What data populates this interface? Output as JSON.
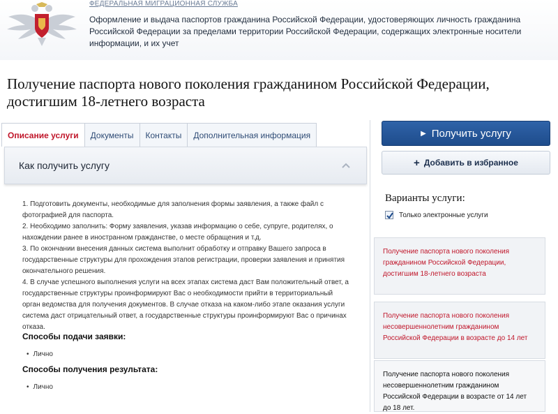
{
  "header": {
    "agency": "ФЕДЕРАЛЬНАЯ МИГРАЦИОННАЯ СЛУЖБА",
    "subtitle": "Оформление и выдача паспортов гражданина Российской Федерации, удостоверяющих личность гражданина Российской Федерации за пределами территории Российской Федерации, содержащих электронные носители информации, и их учет"
  },
  "page": {
    "title": "Получение паспорта нового поколения гражданином Российской Федерации, достигшим 18-летнего возраста"
  },
  "tabs": [
    {
      "label": "Описание услуги",
      "active": true
    },
    {
      "label": "Документы",
      "active": false
    },
    {
      "label": "Контакты",
      "active": false
    },
    {
      "label": "Дополнительная информация",
      "active": false
    }
  ],
  "section": {
    "title": "Как получить услугу",
    "steps": [
      "1. Подготовить документы, необходимые для заполнения формы заявления, а также файл с фотографией для паспорта.",
      "2. Необходимо заполнить: Форму заявления, указав информацию о себе, супруге, родителях, о нахождении ранее в иностранном гражданстве, о месте обращения и т.д.",
      "3. По окончании внесения данных система выполнит обработку и отправку Вашего запроса в государственные структуры для прохождения этапов регистрации, проверки заявления и принятия окончательного решения.",
      "4. В случае успешного выполнения услуги на всех этапах система даст Вам положительный ответ, а государственные структуры проинформируют Вас о необходимости прийти в территориальный орган ведомства для получения документов. В случае отказа на каком-либо этапе оказания услуги система даст отрицательный ответ, а государственные структуры проинформируют Вас о причинах отказа."
    ],
    "submit_heading": "Способы подачи заявки:",
    "submit_items": [
      "Лично"
    ],
    "result_heading": "Способы получения результата:",
    "result_items": [
      "Лично"
    ]
  },
  "actions": {
    "get_service": "Получить услугу",
    "add_favorite": "Добавить в избранное"
  },
  "variants": {
    "title": "Варианты услуги:",
    "filter_label": "Только электронные услуги",
    "filter_checked": true,
    "items": [
      "Получение паспорта нового поколения гражданином Российской Федерации, достигшим 18-летнего возраста",
      "Получение паспорта нового поколения несовершеннолетним гражданином Российской Федерации в возрасте до 14 лет",
      "Получение паспорта нового поколения несовершеннолетним гражданином Российской Федерации в возрасте от 14 лет до 18 лет."
    ]
  },
  "colors": {
    "accent": "#1e4c8c",
    "link_red": "#c0162a",
    "tab_text": "#2e4b75"
  },
  "icons": {
    "emblem": "double-headed-eagle-emblem",
    "chevron": "chevron-up-icon",
    "play": "play-triangle-icon",
    "plus": "plus-icon",
    "check": "checkmark-icon"
  }
}
